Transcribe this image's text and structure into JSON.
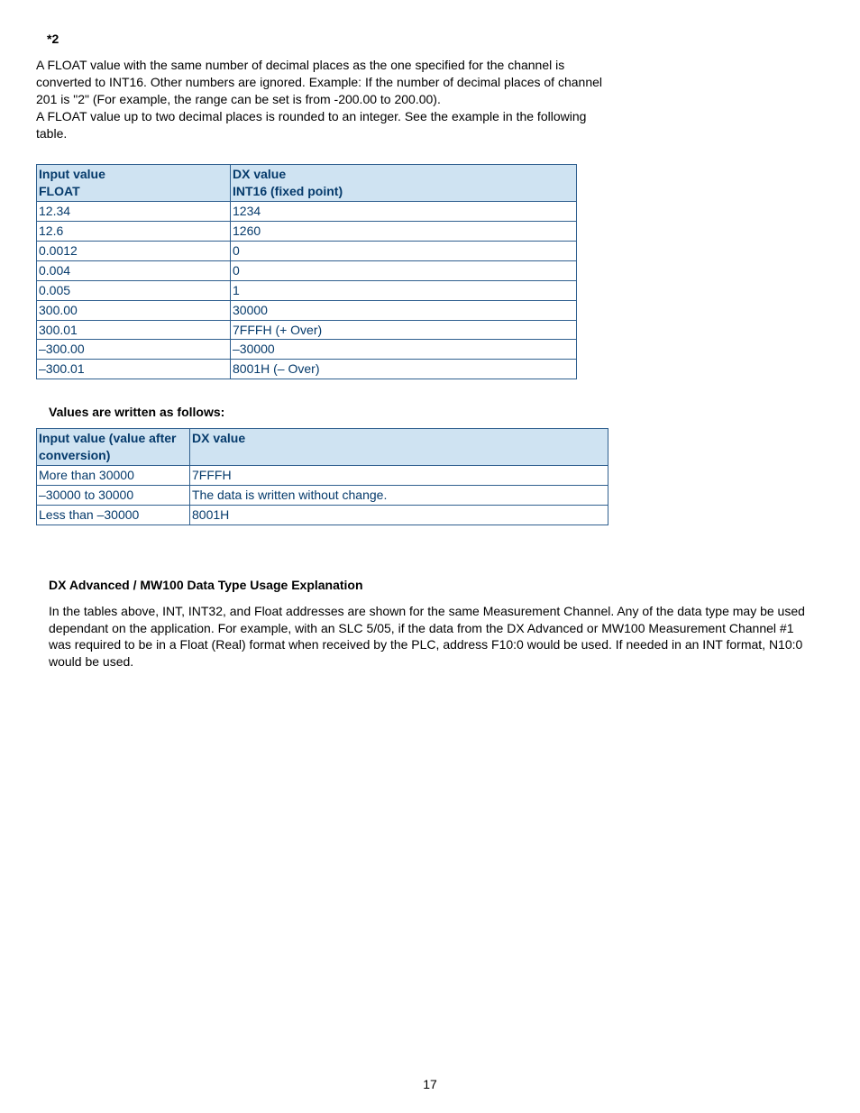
{
  "note_label": "*2",
  "intro_text": "A FLOAT value with the same number of decimal places as the one specified for the channel is converted to INT16. Other numbers are ignored. Example: If the number of decimal places of channel 201 is \"2\" (For example, the range can be set is from -200.00 to 200.00).\nA FLOAT value up to two decimal places is rounded to an integer. See the example in the following table.",
  "table1": {
    "header": {
      "col1_line1": "Input value",
      "col1_line2": "FLOAT",
      "col2_line1": "DX value",
      "col2_line2": "INT16 (fixed point)"
    },
    "rows": [
      {
        "c1": "12.34",
        "c2": "1234"
      },
      {
        "c1": "12.6",
        "c2": "1260"
      },
      {
        "c1": "0.0012",
        "c2": "0"
      },
      {
        "c1": "0.004",
        "c2": "0"
      },
      {
        "c1": "0.005",
        "c2": "1"
      },
      {
        "c1": "300.00",
        "c2": "30000"
      },
      {
        "c1": "300.01",
        "c2": "7FFFH (+ Over)"
      },
      {
        "c1": "–300.00",
        "c2": "–30000"
      },
      {
        "c1": "–300.01",
        "c2": "8001H (– Over)"
      }
    ]
  },
  "heading_values": "Values are written as follows:",
  "table2": {
    "header": {
      "col1": "Input value (value after conversion)",
      "col2": "DX value"
    },
    "rows": [
      {
        "c1": "More than 30000",
        "c2": "7FFFH"
      },
      {
        "c1": "–30000 to 30000",
        "c2": "The data is written without change."
      },
      {
        "c1": "Less than –30000",
        "c2": "8001H"
      }
    ]
  },
  "heading_explanation": "DX Advanced / MW100 Data Type Usage Explanation",
  "explanation_text": "In the tables above, INT, INT32, and Float addresses are shown for the same Measurement Channel. Any of the data type may be used dependant on the application. For example, with an SLC 5/05, if the data from the DX Advanced or MW100 Measurement Channel #1 was required to be in a Float (Real) format when received by the PLC, address F10:0 would be used. If needed in an INT format, N10:0 would be used.",
  "page_number": "17"
}
